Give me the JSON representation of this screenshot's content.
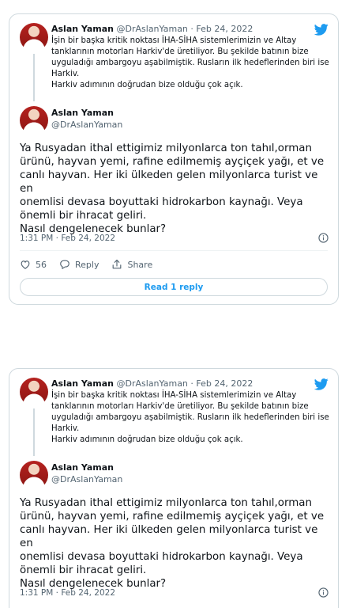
{
  "tweet": {
    "author_name": "Aslan Yaman",
    "author_handle": "@DrAslanYaman",
    "quoted": {
      "name": "Aslan Yaman",
      "handle": "@DrAslanYaman",
      "separator": "·",
      "date": "Feb 24, 2022",
      "text_lines": [
        "İşin bir başka kritik noktası İHA-SİHA sistemlerimizin ve Altay",
        "tanklarının motorları  Harkiv'de üretiliyor. Bu şekilde batının bize",
        "uyguladığı ambargoyu aşabilmiştik. Rusların ilk hedeflerinden biri ise",
        "Harkiv.",
        "Harkiv adımının doğrudan bize olduğu çok açık."
      ]
    },
    "text_lines": [
      "Ya Rusyadan ithal ettigimiz milyonlarca ton tahıl,orman",
      "ürünü, hayvan yemi, rafine edilmemiş ayçiçek yağı, et ve",
      "canlı hayvan. Her iki ülkeden gelen milyonlarca turist ve en",
      "onemlisi devasa boyuttaki hidrokarbon kaynağı. Veya",
      "önemli bir ihracat geliri.",
      "Nasıl dengelenecek bunlar?"
    ],
    "timestamp": "1:31 PM · Feb 24, 2022",
    "like_count": "56",
    "reply_label": "Reply",
    "share_label": "Share",
    "read_reply_label": "Read 1 reply"
  },
  "colors": {
    "accent": "#1d9bf0",
    "secondary_text": "#536471",
    "border": "#cfd9de"
  },
  "icons": [
    "twitter-bird-icon",
    "info-icon",
    "heart-icon",
    "reply-bubble-icon",
    "share-icon"
  ]
}
